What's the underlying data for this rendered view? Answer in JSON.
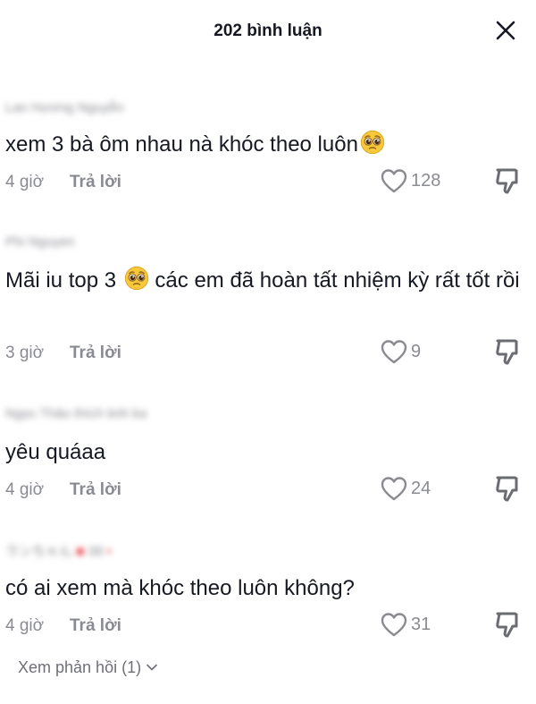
{
  "header": {
    "title": "202 bình luận"
  },
  "comments": [
    {
      "username": "Lan Hương Nguyễn",
      "text": "xem 3 bà ôm nhau nà khóc theo luôn",
      "time": "4 giờ",
      "reply_label": "Trả lời",
      "likes": "128"
    },
    {
      "username": "Phi Nguyen",
      "text_before": "Mãi iu top 3",
      "text_after": "các em đã hoàn tất nhiệm kỳ rất tốt rồi",
      "time": "3 giờ",
      "reply_label": "Trả lời",
      "likes": "9"
    },
    {
      "username": "Ngọc Thảo thích tinh ka",
      "text": "yêu quáaa",
      "time": "4 giờ",
      "reply_label": "Trả lời",
      "likes": "24"
    },
    {
      "username": "ランちゃん",
      "username_extra": "38",
      "text": "có ai xem mà khóc theo luôn không?",
      "time": "4 giờ",
      "reply_label": "Trả lời",
      "likes": "31"
    }
  ],
  "view_replies": "Xem phản hồi (1)",
  "icons": {
    "close": "close-icon",
    "like": "heart-outline-icon",
    "dislike": "thumbs-down-icon",
    "emoji": "pleading-face-emoji",
    "chevron": "chevron-down-icon"
  }
}
